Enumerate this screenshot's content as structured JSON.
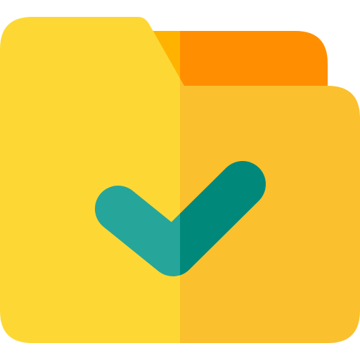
{
  "icon": {
    "name": "folder-check-icon",
    "colors": {
      "folder_tab_back_left": "#FFB300",
      "folder_tab_back_right": "#FF8F00",
      "folder_front_left": "#FDD835",
      "folder_front_right": "#FBC02D",
      "check_left": "#26A69A",
      "check_right": "#00897B",
      "background": "#FFFFFF"
    }
  }
}
